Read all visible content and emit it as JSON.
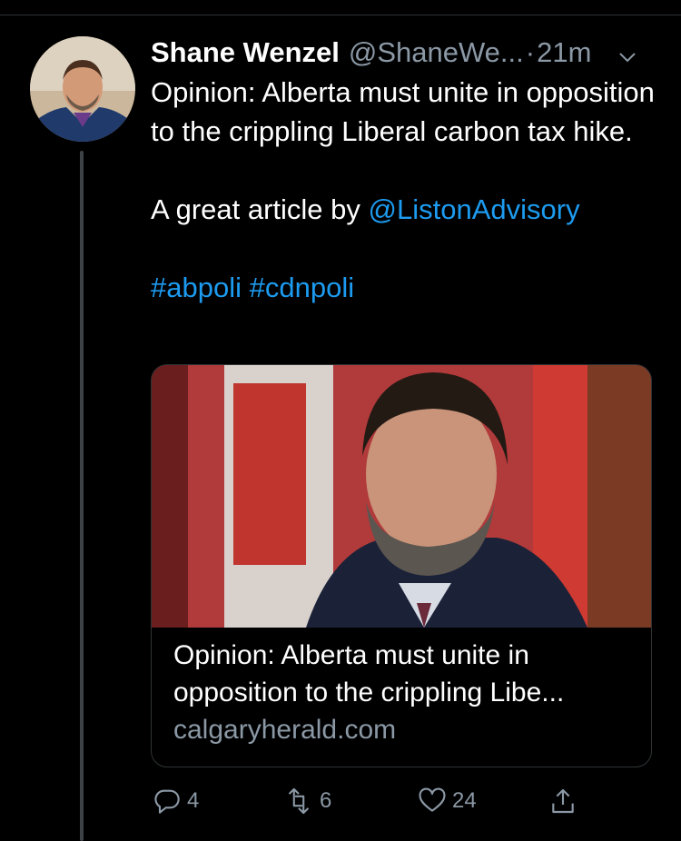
{
  "tweet": {
    "author_name": "Shane Wenzel",
    "handle": "@ShaneWe...",
    "separator": "·",
    "time": "21m",
    "text_line1": "Opinion: Alberta must unite in opposition to the crippling Liberal carbon tax hike.",
    "text_line2_prefix": "A great article by ",
    "mention": "@ListonAdvisory",
    "hashtags": [
      "#abpoli",
      "#cdnpoli"
    ]
  },
  "card": {
    "title": "Opinion: Alberta must unite in opposition to the crippling Libe...",
    "domain": "calgaryherald.com"
  },
  "actions": {
    "replies": "4",
    "retweets": "6",
    "likes": "24"
  },
  "colors": {
    "background": "#000000",
    "text": "#ffffff",
    "secondary": "#8b98a5",
    "link": "#1d9bf0",
    "border": "#2f3336"
  },
  "icons": [
    "caret-down-icon",
    "reply-icon",
    "retweet-icon",
    "like-icon",
    "share-icon"
  ]
}
